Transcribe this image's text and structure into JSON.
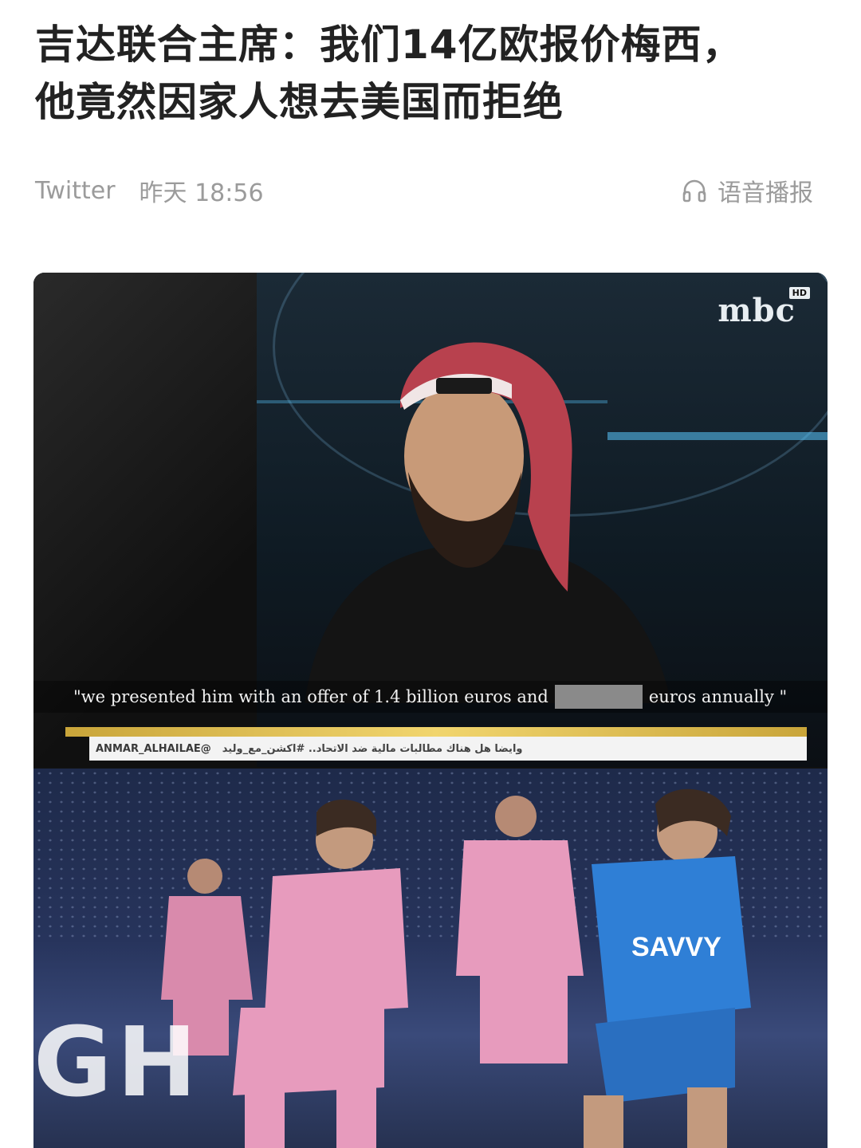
{
  "article": {
    "title_line1": "吉达联合主席：我们14亿欧报价梅西，",
    "title_line2": "他竟然因家人想去美国而拒绝",
    "source": "Twitter",
    "time": "昨天 18:56",
    "audio_label": "语音播报"
  },
  "image": {
    "tv_logo": "mbc",
    "tv_logo_badge": "HD",
    "subtitle_before": "\"we presented him with an offer of 1.4 billion euros and",
    "subtitle_after": "euros annually \"",
    "ticker_handle": "ANMAR_ALHAILAE@",
    "ticker_text": "وايضا هل هناك مطالبات مالية ضد الاتحاد.. #اكشن_مع_وليد",
    "jersey_sponsor": "SAVVY",
    "board_text": "GH"
  },
  "icons": {
    "audio": "headphones-icon"
  },
  "colors": {
    "title": "#222222",
    "meta": "#9b9b9b",
    "pink_kit": "#e79bbd",
    "blue_kit": "#2f7fd6"
  }
}
